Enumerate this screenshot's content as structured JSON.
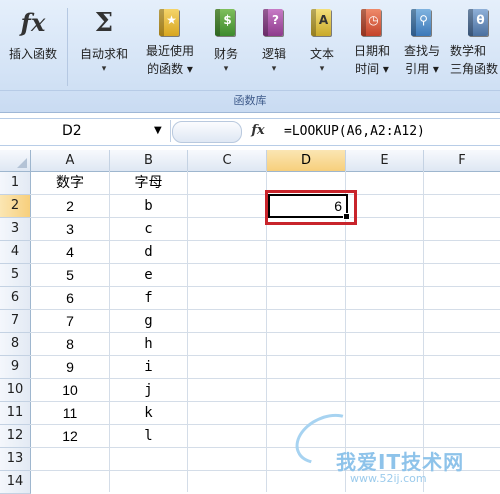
{
  "ribbon": {
    "buttons": [
      {
        "label": "插入函数",
        "icon": "fx",
        "arrow": false
      },
      {
        "label": "自动求和",
        "icon": "Σ",
        "arrow": true
      },
      {
        "label": "最近使用\n的函数",
        "icon": "star-book",
        "arrow": true
      },
      {
        "label": "财务",
        "icon": "$-book",
        "arrow": true
      },
      {
        "label": "逻辑",
        "icon": "?-book",
        "arrow": true
      },
      {
        "label": "文本",
        "icon": "A-book",
        "arrow": true
      },
      {
        "label": "日期和\n时间",
        "icon": "clock-book",
        "arrow": true
      },
      {
        "label": "查找与\n引用",
        "icon": "magnifier-book",
        "arrow": true
      },
      {
        "label": "数学和\n三角函数",
        "icon": "θ-book",
        "arrow": false
      }
    ],
    "group_label": "函数库"
  },
  "formula_bar": {
    "name_box": "D2",
    "fx_label": "fx",
    "formula": "=LOOKUP(A6,A2:A12)"
  },
  "sheet": {
    "columns": [
      "A",
      "B",
      "C",
      "D",
      "E",
      "F"
    ],
    "rows": [
      "1",
      "2",
      "3",
      "4",
      "5",
      "6",
      "7",
      "8",
      "9",
      "10",
      "11",
      "12",
      "13",
      "14"
    ],
    "active_column": "D",
    "active_row": "2",
    "header_row": {
      "a": "数字",
      "b": "字母"
    },
    "data": [
      {
        "a": "2",
        "b": "b"
      },
      {
        "a": "3",
        "b": "c"
      },
      {
        "a": "4",
        "b": "d"
      },
      {
        "a": "5",
        "b": "e"
      },
      {
        "a": "6",
        "b": "f"
      },
      {
        "a": "7",
        "b": "g"
      },
      {
        "a": "8",
        "b": "h"
      },
      {
        "a": "9",
        "b": "i"
      },
      {
        "a": "10",
        "b": "j"
      },
      {
        "a": "11",
        "b": "k"
      },
      {
        "a": "12",
        "b": "l"
      }
    ],
    "d2_value": "6"
  },
  "watermark": {
    "text": "我爱IT技术网",
    "url": "www.52ij.com"
  },
  "colors": {
    "highlight": "#c8242b",
    "active_header": "#f7cf7c",
    "watermark": "#8ec3ea"
  }
}
